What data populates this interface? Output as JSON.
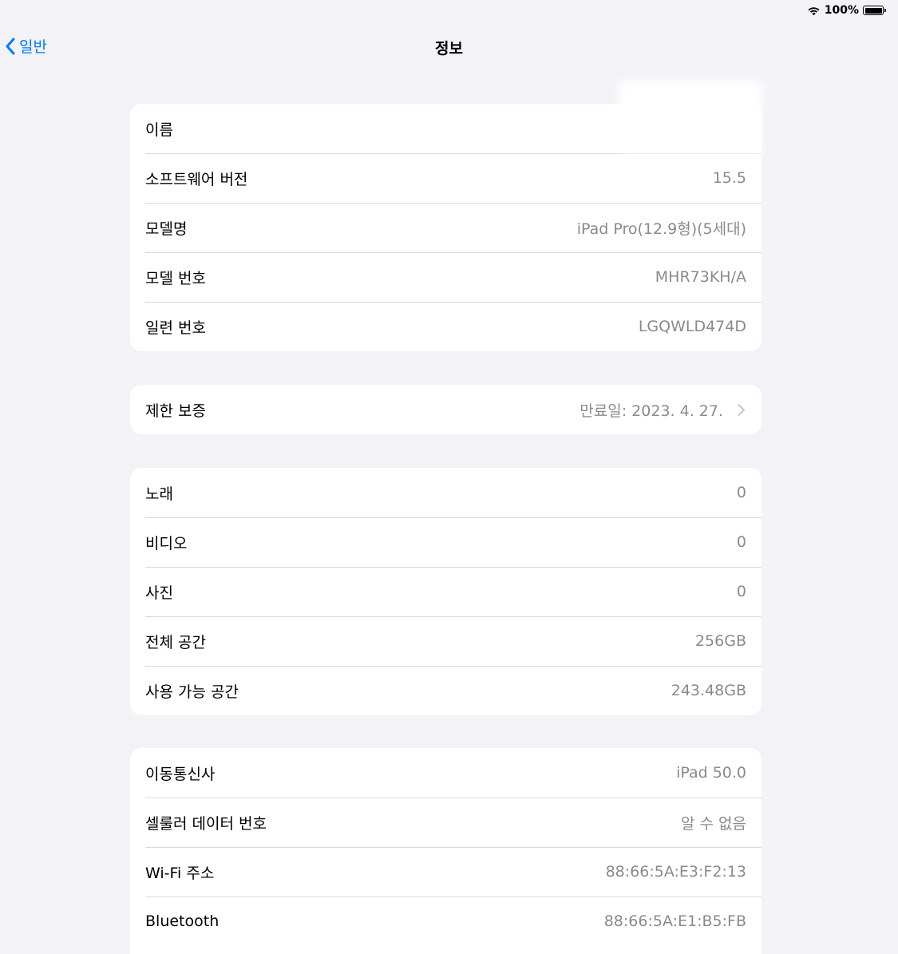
{
  "status": {
    "battery_percent": "100%",
    "battery_level": 1.0
  },
  "nav": {
    "back_label": "일반",
    "title": "정보"
  },
  "group_device": [
    {
      "label": "이름",
      "value": ""
    },
    {
      "label": "소프트웨어 버전",
      "value": "15.5"
    },
    {
      "label": "모델명",
      "value": "iPad Pro(12.9형)(5세대)"
    },
    {
      "label": "모델 번호",
      "value": "MHR73KH/A"
    },
    {
      "label": "일련 번호",
      "value": "LGQWLD474D"
    }
  ],
  "group_warranty": {
    "label": "제한 보증",
    "value": "만료일: 2023. 4. 27."
  },
  "group_media": [
    {
      "label": "노래",
      "value": "0"
    },
    {
      "label": "비디오",
      "value": "0"
    },
    {
      "label": "사진",
      "value": "0"
    },
    {
      "label": "전체 공간",
      "value": "256GB"
    },
    {
      "label": "사용 가능 공간",
      "value": "243.48GB"
    }
  ],
  "group_network": [
    {
      "label": "이동통신사",
      "value": "iPad 50.0"
    },
    {
      "label": "셀룰러 데이터 번호",
      "value": "알 수 없음"
    },
    {
      "label": "Wi-Fi 주소",
      "value": "88:66:5A:E3:F2:13"
    },
    {
      "label": "Bluetooth",
      "value": "88:66:5A:E1:B5:FB"
    }
  ],
  "icons": {
    "wifi": "wifi-icon",
    "battery": "battery-icon",
    "back": "chevron-left-icon",
    "disclosure": "chevron-right-icon"
  },
  "colors": {
    "accent": "#007aff",
    "background": "#f2f2f7",
    "secondary_text": "#8a8a8e"
  }
}
